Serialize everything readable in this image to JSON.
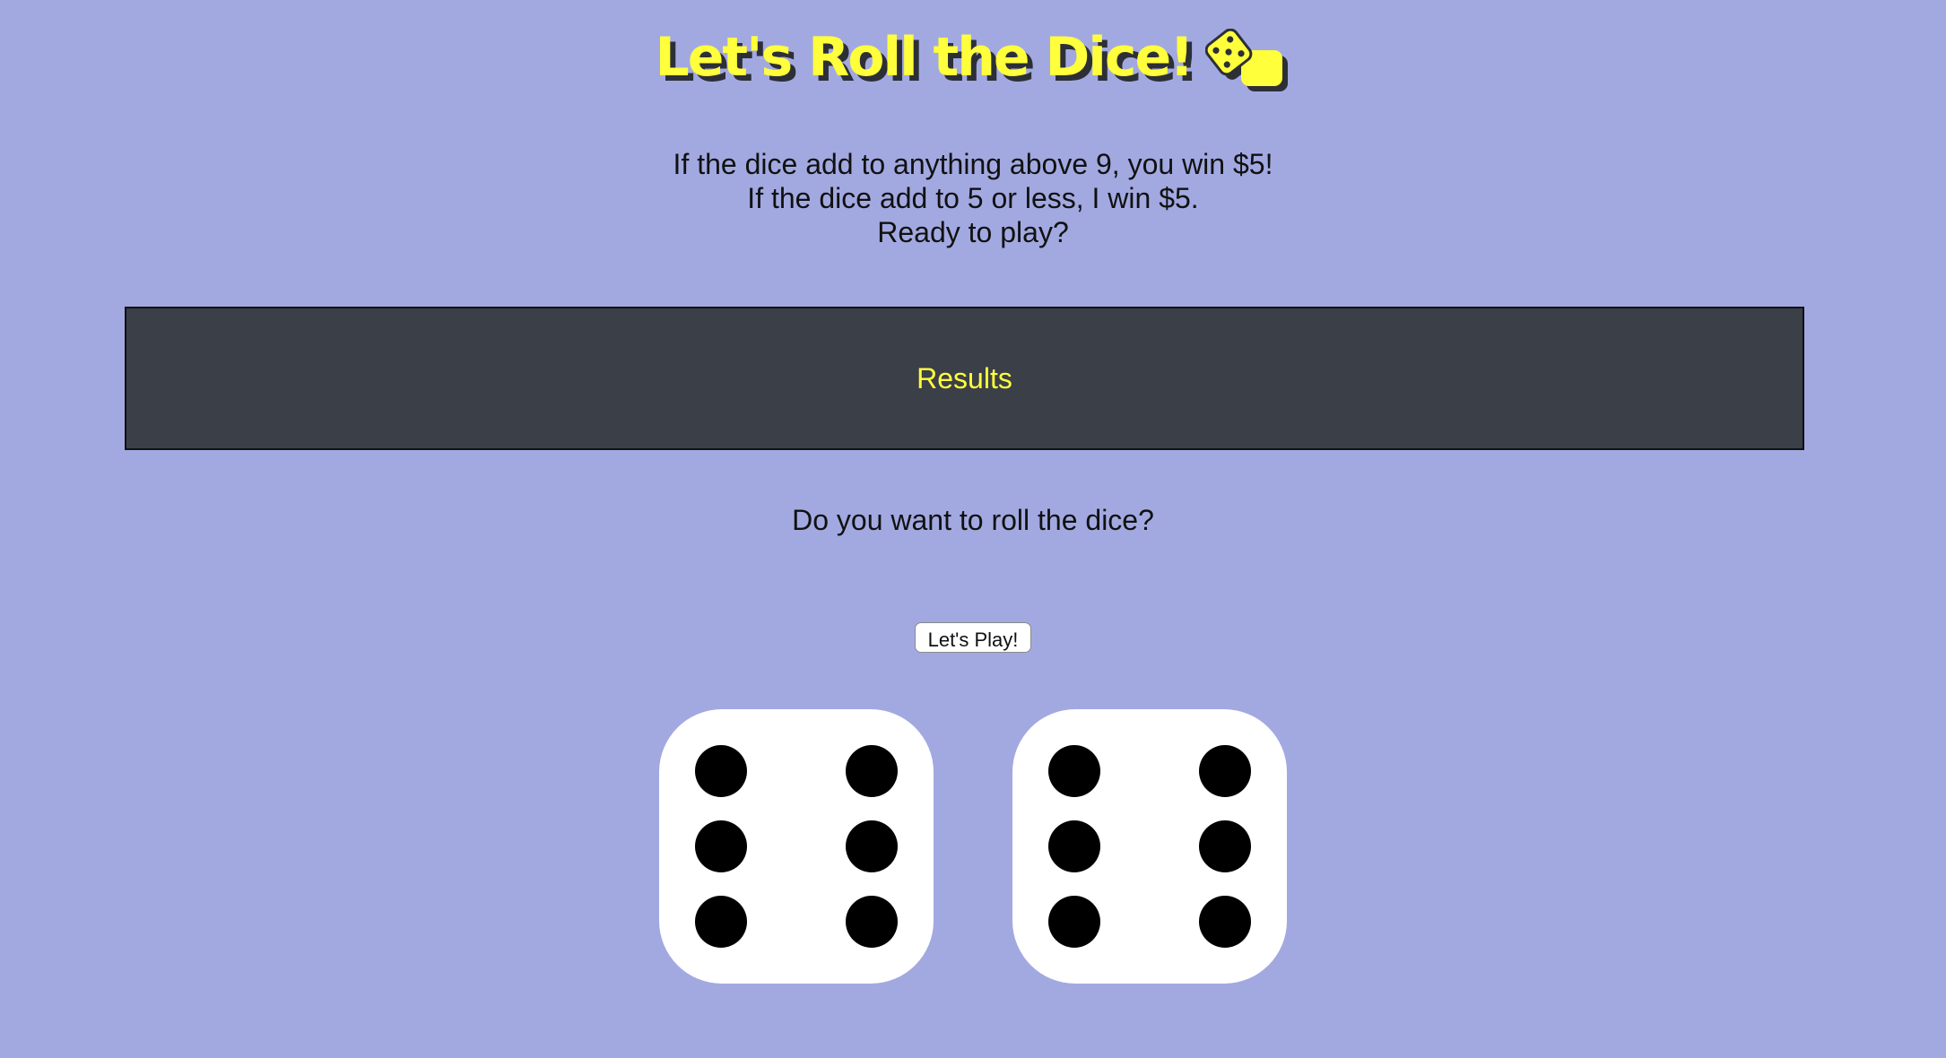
{
  "header": {
    "title": "Let's Roll the Dice!",
    "icon": "game-die-icon",
    "title_color": "#ffff3c",
    "shadow_color": "#2d2f36"
  },
  "intro": {
    "line1": "If the dice add to anything above 9, you win $5!",
    "line2": "If the dice add to 5 or less, I win $5.",
    "line3": "Ready to play?"
  },
  "results": {
    "label": "Results",
    "background": "#3b3f48",
    "text_color": "#ffff3c"
  },
  "question": "Do you want to roll the dice?",
  "play_button": {
    "label": "Let's Play!"
  },
  "dice": [
    {
      "value": 6
    },
    {
      "value": 6
    }
  ],
  "colors": {
    "background": "#a2a9e1",
    "die_face": "#ffffff",
    "pip": "#000000"
  }
}
